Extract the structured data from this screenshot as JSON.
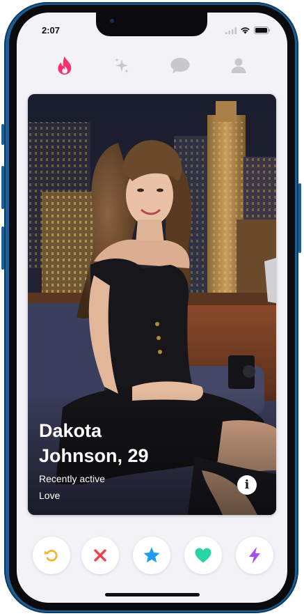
{
  "status_bar": {
    "time": "2:07"
  },
  "top_nav": {
    "items": [
      {
        "icon": "flame-icon",
        "active": true,
        "color": "#fd2f6c"
      },
      {
        "icon": "sparkle-icon",
        "active": false,
        "color": "#c8c8cc"
      },
      {
        "icon": "chat-bubble-icon",
        "active": false,
        "color": "#c8c8cc"
      },
      {
        "icon": "profile-icon",
        "active": false,
        "color": "#c8c8cc"
      }
    ]
  },
  "profile_card": {
    "name_line1": "Dakota",
    "name_line2": "Johnson, 29",
    "status": "Recently active",
    "interest": "Love",
    "info_glyph": "i"
  },
  "action_bar": {
    "buttons": [
      {
        "icon": "rewind-icon",
        "color": "#f5b52d"
      },
      {
        "icon": "close-icon",
        "color": "#f5404f"
      },
      {
        "icon": "star-icon",
        "color": "#1f9cf0"
      },
      {
        "icon": "heart-icon",
        "color": "#28d6a4"
      },
      {
        "icon": "bolt-icon",
        "color": "#a44cf5"
      }
    ]
  }
}
